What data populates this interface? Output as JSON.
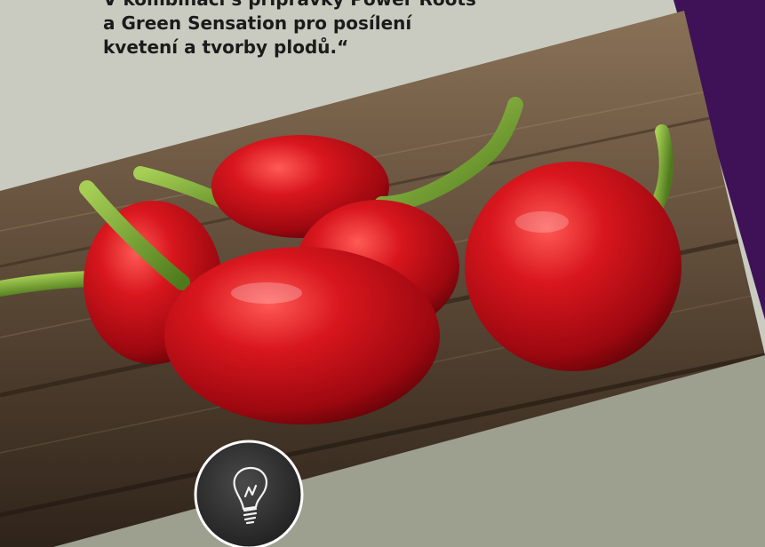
{
  "quote": {
    "lines": [
      "V kombinaci s přípravky Power Roots",
      "a Green Sensation pro posílení",
      "kvetení a tvorby plodů.“"
    ]
  },
  "colors": {
    "top_background": "#c9cbc0",
    "bottom_panel": "#9ea08f",
    "purple_band": "#3f1258",
    "wood_dark": "#3b2c20",
    "pepper_red": "#c0101a",
    "stem_green": "#6c9b2a",
    "quote_text": "#1b1b1b",
    "badge_dark": "#2b2b2b"
  },
  "icons": {
    "badge": "lightbulb-icon"
  }
}
